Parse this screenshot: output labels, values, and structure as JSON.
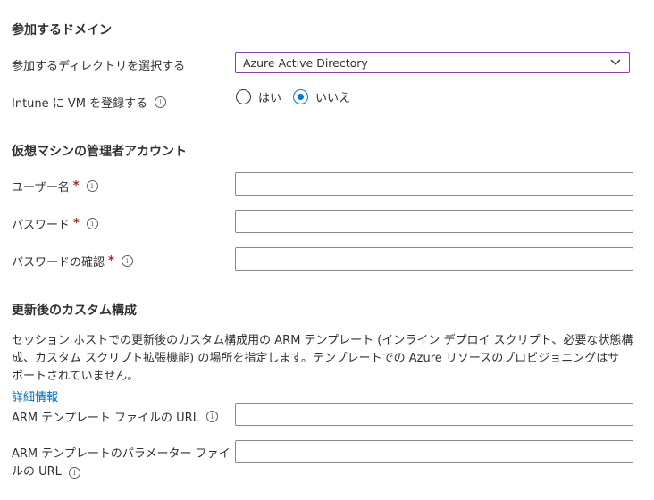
{
  "domain_section": {
    "title": "参加するドメイン",
    "directory_label": "参加するディレクトリを選択する",
    "directory_value": "Azure Active Directory",
    "intune_label": "Intune に VM を登録する",
    "radio_yes": "はい",
    "radio_no": "いいえ",
    "selected": "いいえ"
  },
  "admin_section": {
    "title": "仮想マシンの管理者アカウント",
    "username_label": "ユーザー名",
    "password_label": "パスワード",
    "confirm_label": "パスワードの確認",
    "required_mark": "*"
  },
  "custom_section": {
    "title": "更新後のカスタム構成",
    "description_line1": "セッション ホストでの更新後のカスタム構成用の ARM テンプレート (インライン デプロイ スクリプト、必要な状態構",
    "description_line2": "成、カスタム スクリプト拡張機能) の場所を指定します。テンプレートでの Azure リソースのプロビジョニングはサ",
    "description_line3": "ポートされていません。",
    "learn_more": "詳細情報",
    "template_url_label": "ARM テンプレート ファイルの URL",
    "param_url_label_line1": "ARM テンプレートのパラメーター ファイ",
    "param_url_label_line2": "ルの URL"
  },
  "colors": {
    "accent": "#0078d4",
    "link": "#0067b8",
    "required": "#a4262c",
    "focus_border": "#8a3ea8"
  }
}
